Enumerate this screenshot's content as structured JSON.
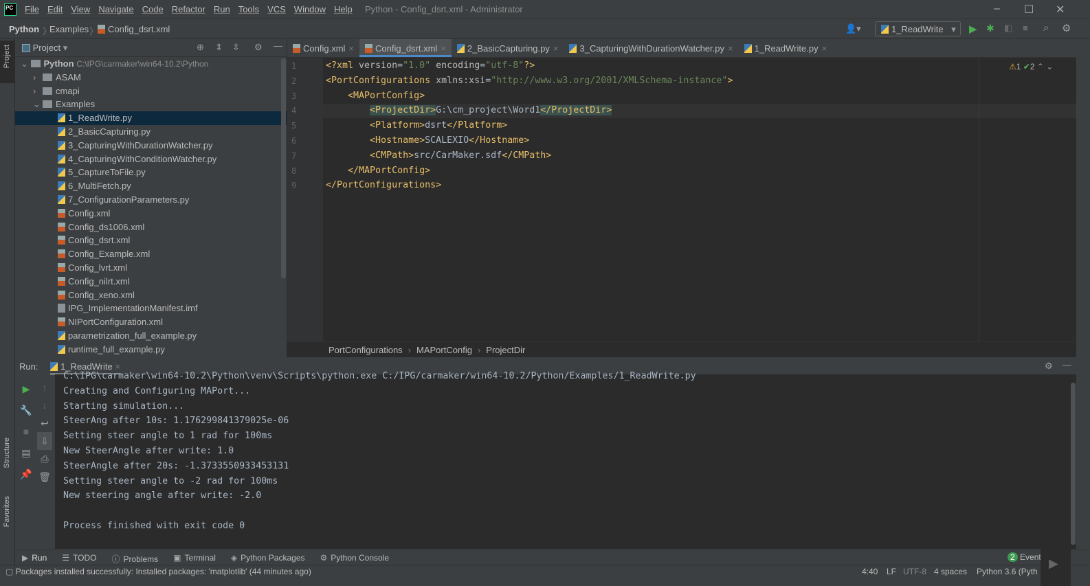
{
  "titlebar": {
    "menu": [
      "File",
      "Edit",
      "View",
      "Navigate",
      "Code",
      "Refactor",
      "Run",
      "Tools",
      "VCS",
      "Window",
      "Help"
    ],
    "title": "Python - Config_dsrt.xml - Administrator"
  },
  "navbar": {
    "crumbs": [
      "Python",
      "Examples",
      "Config_dsrt.xml"
    ],
    "run_config": "1_ReadWrite"
  },
  "sidestrip": {
    "project": "Project",
    "structure": "Structure",
    "favorites": "Favorites"
  },
  "project": {
    "title": "Project",
    "root": {
      "name": "Python",
      "path": "C:\\IPG\\carmaker\\win64-10.2\\Python"
    },
    "items": [
      {
        "label": "ASAM",
        "type": "folder",
        "depth": 1,
        "expanded": false
      },
      {
        "label": "cmapi",
        "type": "folder",
        "depth": 1,
        "expanded": false
      },
      {
        "label": "Examples",
        "type": "folder",
        "depth": 1,
        "expanded": true
      },
      {
        "label": "1_ReadWrite.py",
        "type": "py",
        "depth": 2,
        "selected": true
      },
      {
        "label": "2_BasicCapturing.py",
        "type": "py",
        "depth": 2
      },
      {
        "label": "3_CapturingWithDurationWatcher.py",
        "type": "py",
        "depth": 2
      },
      {
        "label": "4_CapturingWithConditionWatcher.py",
        "type": "py",
        "depth": 2
      },
      {
        "label": "5_CaptureToFile.py",
        "type": "py",
        "depth": 2
      },
      {
        "label": "6_MultiFetch.py",
        "type": "py",
        "depth": 2
      },
      {
        "label": "7_ConfigurationParameters.py",
        "type": "py",
        "depth": 2
      },
      {
        "label": "Config.xml",
        "type": "xml",
        "depth": 2
      },
      {
        "label": "Config_ds1006.xml",
        "type": "xml",
        "depth": 2
      },
      {
        "label": "Config_dsrt.xml",
        "type": "xml",
        "depth": 2
      },
      {
        "label": "Config_Example.xml",
        "type": "xml",
        "depth": 2
      },
      {
        "label": "Config_lvrt.xml",
        "type": "xml",
        "depth": 2
      },
      {
        "label": "Config_nilrt.xml",
        "type": "xml",
        "depth": 2
      },
      {
        "label": "Config_xeno.xml",
        "type": "xml",
        "depth": 2
      },
      {
        "label": "IPG_ImplementationManifest.imf",
        "type": "imf",
        "depth": 2
      },
      {
        "label": "NIPortConfiguration.xml",
        "type": "xml",
        "depth": 2
      },
      {
        "label": "parametrization_full_example.py",
        "type": "py",
        "depth": 2
      },
      {
        "label": "runtime_full_example.py",
        "type": "py",
        "depth": 2
      }
    ]
  },
  "editor": {
    "tabs": [
      {
        "label": "Config.xml",
        "type": "xml"
      },
      {
        "label": "Config_dsrt.xml",
        "type": "xml",
        "active": true
      },
      {
        "label": "2_BasicCapturing.py",
        "type": "py"
      },
      {
        "label": "3_CapturingWithDurationWatcher.py",
        "type": "py"
      },
      {
        "label": "1_ReadWrite.py",
        "type": "py"
      }
    ],
    "warnings": "1",
    "checks": "2",
    "lines": [
      "<?xml version=\"1.0\" encoding=\"utf-8\"?>",
      "<PortConfigurations xmlns:xsi=\"http://www.w3.org/2001/XMLSchema-instance\">",
      "    <MAPortConfig>",
      "        <ProjectDir>G:\\cm_project\\Word1</ProjectDir>",
      "        <Platform>dsrt</Platform>",
      "        <Hostname>SCALEXIO</Hostname>",
      "        <CMPath>src/CarMaker.sdf</CMPath>",
      "    </MAPortConfig>",
      "</PortConfigurations>"
    ],
    "current_line": 4,
    "breadcrumbs": [
      "PortConfigurations",
      "MAPortConfig",
      "ProjectDir"
    ]
  },
  "run": {
    "label": "Run:",
    "tab": "1_ReadWrite",
    "output": [
      "C:\\IPG\\carmaker\\win64-10.2\\Python\\venv\\Scripts\\python.exe C:/IPG/carmaker/win64-10.2/Python/Examples/1_ReadWrite.py",
      "Creating and Configuring MAPort...",
      "Starting simulation...",
      "SteerAng after 10s: 1.176299841379025e-06",
      "Setting steer angle to 1 rad for 100ms",
      "New SteerAngle after write: 1.0",
      "SteerAngle after 20s: -1.3733550933453131",
      "Setting steer angle to -2 rad for 100ms",
      "New steering angle after write: -2.0",
      "",
      "Process finished with exit code 0"
    ]
  },
  "bottombar": {
    "tabs": [
      "Run",
      "TODO",
      "Problems",
      "Terminal",
      "Python Packages",
      "Python Console"
    ],
    "event_count": "2",
    "event_label": "Event"
  },
  "statusbar": {
    "message": "Packages installed successfully: Installed packages: 'matplotlib' (44 minutes ago)",
    "position": "4:40",
    "line_sep": "LF",
    "encoding": "UTF-8",
    "indent": "4 spaces",
    "interpreter": "Python 3.6 (Pyth"
  }
}
